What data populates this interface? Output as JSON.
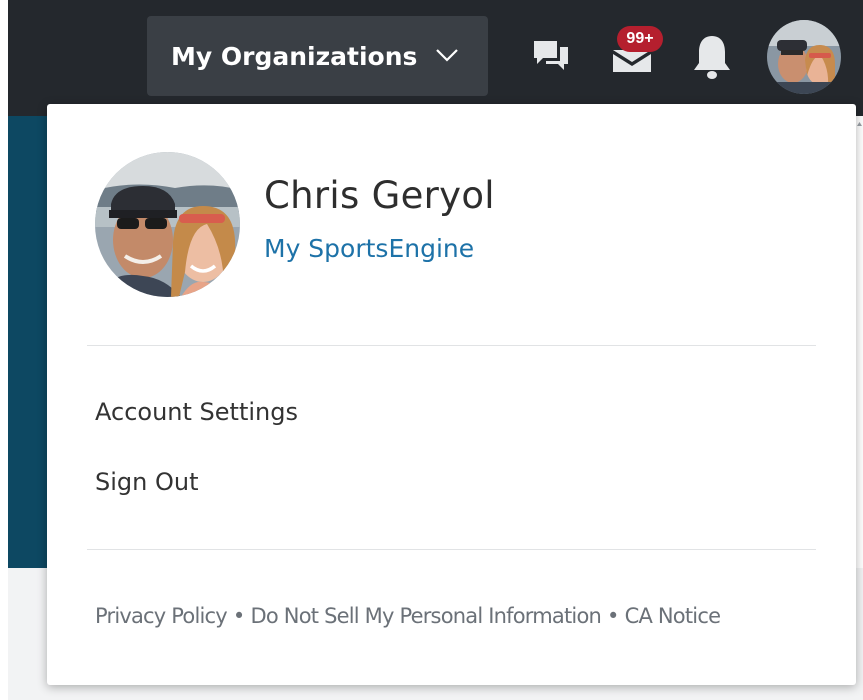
{
  "header": {
    "org_button_label": "My Organizations",
    "messages_badge": "99+"
  },
  "profile": {
    "name": "Chris Geryol",
    "link_label": "My SportsEngine"
  },
  "menu": {
    "items": [
      {
        "label": "Account Settings"
      },
      {
        "label": "Sign Out"
      }
    ]
  },
  "footer": {
    "links": [
      {
        "label": "Privacy Policy"
      },
      {
        "label": "Do Not Sell My Personal Information"
      },
      {
        "label": "CA Notice"
      }
    ],
    "separator": "•"
  },
  "icons": {
    "chat": "chat-icon",
    "messages": "envelope-icon",
    "notifications": "bell-icon",
    "dropdown": "chevron-down-icon"
  },
  "colors": {
    "topbar": "#24282d",
    "org_button": "#3a3f45",
    "accent_link": "#1d72a8",
    "badge": "#b51f2e",
    "side_panel": "#0d4862"
  }
}
